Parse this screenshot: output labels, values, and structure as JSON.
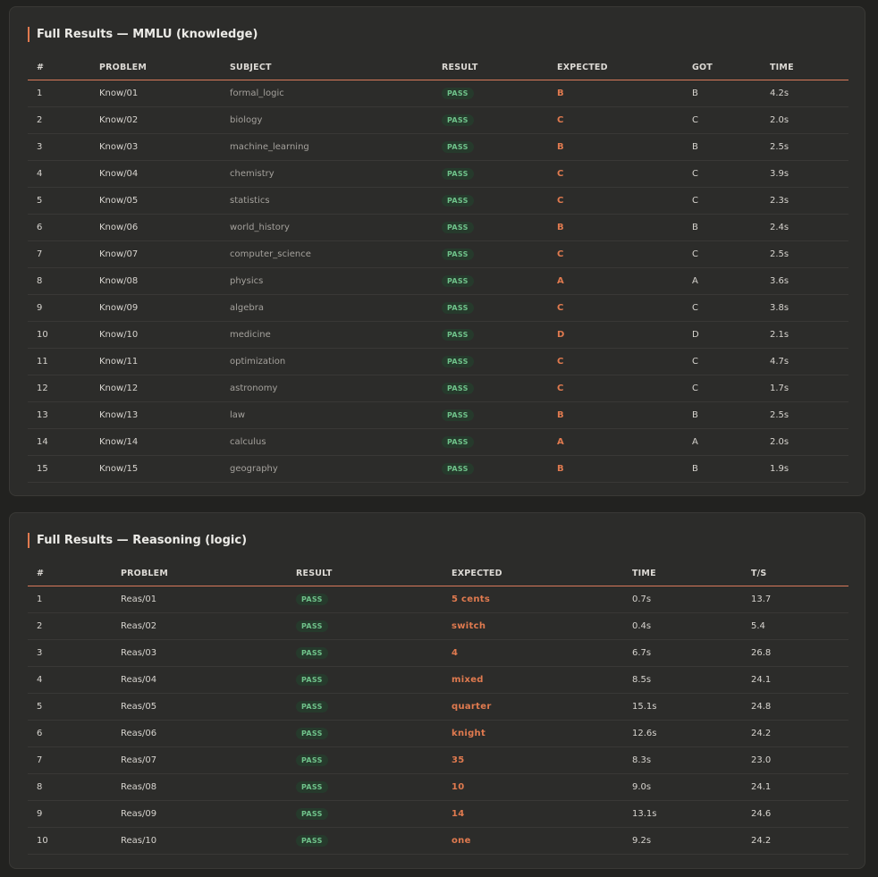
{
  "mmlu": {
    "title": "Full Results — MMLU (knowledge)",
    "headers": [
      "#",
      "PROBLEM",
      "SUBJECT",
      "RESULT",
      "EXPECTED",
      "GOT",
      "TIME"
    ],
    "rows": [
      [
        "1",
        "Know/01",
        "formal_logic",
        "PASS",
        "B",
        "B",
        "4.2s"
      ],
      [
        "2",
        "Know/02",
        "biology",
        "PASS",
        "C",
        "C",
        "2.0s"
      ],
      [
        "3",
        "Know/03",
        "machine_learning",
        "PASS",
        "B",
        "B",
        "2.5s"
      ],
      [
        "4",
        "Know/04",
        "chemistry",
        "PASS",
        "C",
        "C",
        "3.9s"
      ],
      [
        "5",
        "Know/05",
        "statistics",
        "PASS",
        "C",
        "C",
        "2.3s"
      ],
      [
        "6",
        "Know/06",
        "world_history",
        "PASS",
        "B",
        "B",
        "2.4s"
      ],
      [
        "7",
        "Know/07",
        "computer_science",
        "PASS",
        "C",
        "C",
        "2.5s"
      ],
      [
        "8",
        "Know/08",
        "physics",
        "PASS",
        "A",
        "A",
        "3.6s"
      ],
      [
        "9",
        "Know/09",
        "algebra",
        "PASS",
        "C",
        "C",
        "3.8s"
      ],
      [
        "10",
        "Know/10",
        "medicine",
        "PASS",
        "D",
        "D",
        "2.1s"
      ],
      [
        "11",
        "Know/11",
        "optimization",
        "PASS",
        "C",
        "C",
        "4.7s"
      ],
      [
        "12",
        "Know/12",
        "astronomy",
        "PASS",
        "C",
        "C",
        "1.7s"
      ],
      [
        "13",
        "Know/13",
        "law",
        "PASS",
        "B",
        "B",
        "2.5s"
      ],
      [
        "14",
        "Know/14",
        "calculus",
        "PASS",
        "A",
        "A",
        "2.0s"
      ],
      [
        "15",
        "Know/15",
        "geography",
        "PASS",
        "B",
        "B",
        "1.9s"
      ]
    ]
  },
  "reasoning": {
    "title": "Full Results — Reasoning (logic)",
    "headers": [
      "#",
      "PROBLEM",
      "RESULT",
      "EXPECTED",
      "TIME",
      "T/S"
    ],
    "rows": [
      [
        "1",
        "Reas/01",
        "PASS",
        "5 cents",
        "0.7s",
        "13.7"
      ],
      [
        "2",
        "Reas/02",
        "PASS",
        "switch",
        "0.4s",
        "5.4"
      ],
      [
        "3",
        "Reas/03",
        "PASS",
        "4",
        "6.7s",
        "26.8"
      ],
      [
        "4",
        "Reas/04",
        "PASS",
        "mixed",
        "8.5s",
        "24.1"
      ],
      [
        "5",
        "Reas/05",
        "PASS",
        "quarter",
        "15.1s",
        "24.8"
      ],
      [
        "6",
        "Reas/06",
        "PASS",
        "knight",
        "12.6s",
        "24.2"
      ],
      [
        "7",
        "Reas/07",
        "PASS",
        "35",
        "8.3s",
        "23.0"
      ],
      [
        "8",
        "Reas/08",
        "PASS",
        "10",
        "9.0s",
        "24.1"
      ],
      [
        "9",
        "Reas/09",
        "PASS",
        "14",
        "13.1s",
        "24.6"
      ],
      [
        "10",
        "Reas/10",
        "PASS",
        "one",
        "9.2s",
        "24.2"
      ]
    ]
  },
  "colors": {
    "accent": "#e07a4f",
    "pass_text": "#6fc28a",
    "pass_bg": "#263a2c",
    "panel_bg": "#2c2c2a",
    "page_bg": "#222220"
  }
}
